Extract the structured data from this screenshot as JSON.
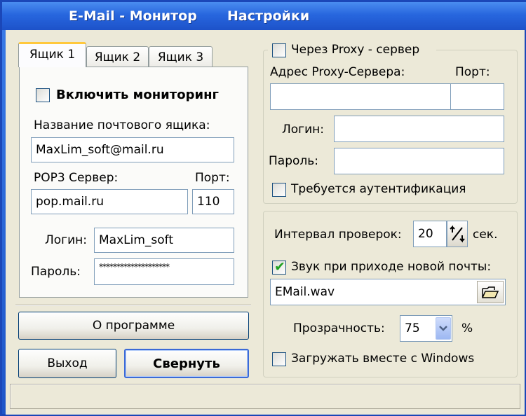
{
  "window": {
    "title": "E-Mail - Монитор",
    "menu_settings": "Настройки"
  },
  "tabs": [
    {
      "label": "Ящик 1",
      "active": true
    },
    {
      "label": "Ящик 2",
      "active": false
    },
    {
      "label": "Ящик 3",
      "active": false
    }
  ],
  "mailbox": {
    "enable_label": "Включить мониторинг",
    "enable_checked": false,
    "name_label": "Название почтового ящика:",
    "name_value": "MaxLim_soft@mail.ru",
    "pop3_label": "POP3 Сервер:",
    "pop3_value": "pop.mail.ru",
    "port_label": "Порт:",
    "port_value": "110",
    "login_label": "Логин:",
    "login_value": "MaxLim_soft",
    "password_label": "Пароль:",
    "password_value": "********************"
  },
  "buttons": {
    "about": "О программе",
    "exit": "Выход",
    "minimize": "Свернуть"
  },
  "proxy": {
    "use_label": "Через Proxy - сервер",
    "use_checked": false,
    "address_label": "Адрес Proxy-Сервера:",
    "address_value": "",
    "port_label": "Порт:",
    "port_value": "",
    "login_label": "Логин:",
    "login_value": "",
    "password_label": "Пароль:",
    "password_value": "",
    "auth_label": "Требуется аутентификация",
    "auth_checked": false
  },
  "settings": {
    "interval_label": "Интервал проверок:",
    "interval_value": "20",
    "interval_unit": "сек.",
    "sound_label": "Звук при приходе новой почты:",
    "sound_checked": true,
    "sound_file": "EMail.wav",
    "opacity_label": "Прозрачность:",
    "opacity_value": "75",
    "opacity_unit": "%",
    "autostart_label": "Загружать вместе с Windows",
    "autostart_checked": false
  },
  "icons": {
    "updown": "spin-arrows-icon",
    "folder": "open-folder-icon",
    "dropdown": "chevron-down-icon",
    "check": "check-icon"
  }
}
